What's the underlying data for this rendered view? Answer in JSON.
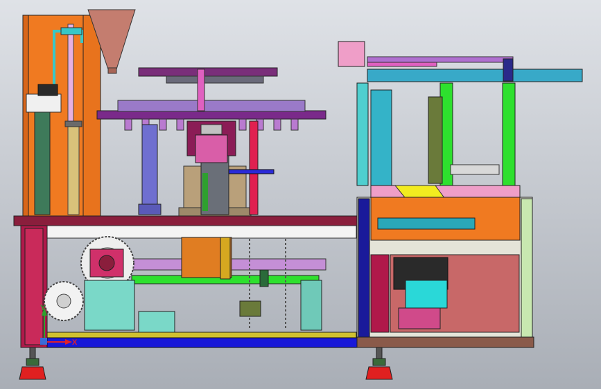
{
  "triad": {
    "x_label": "X",
    "y_label": "Y",
    "x_color": "#e0202a",
    "y_color": "#2ea02e"
  },
  "colors": {
    "background_top": "#d9dde3",
    "background_bottom": "#a8adb5",
    "frame_orange": "#f07a21",
    "base_blue": "#1818d8",
    "table_maroon": "#8a1e3c",
    "accent_magenta": "#d11f8f",
    "accent_green": "#27e03a",
    "accent_cyan": "#38c7c7",
    "gear_white": "#eeeeee",
    "foot_red": "#e02020"
  }
}
